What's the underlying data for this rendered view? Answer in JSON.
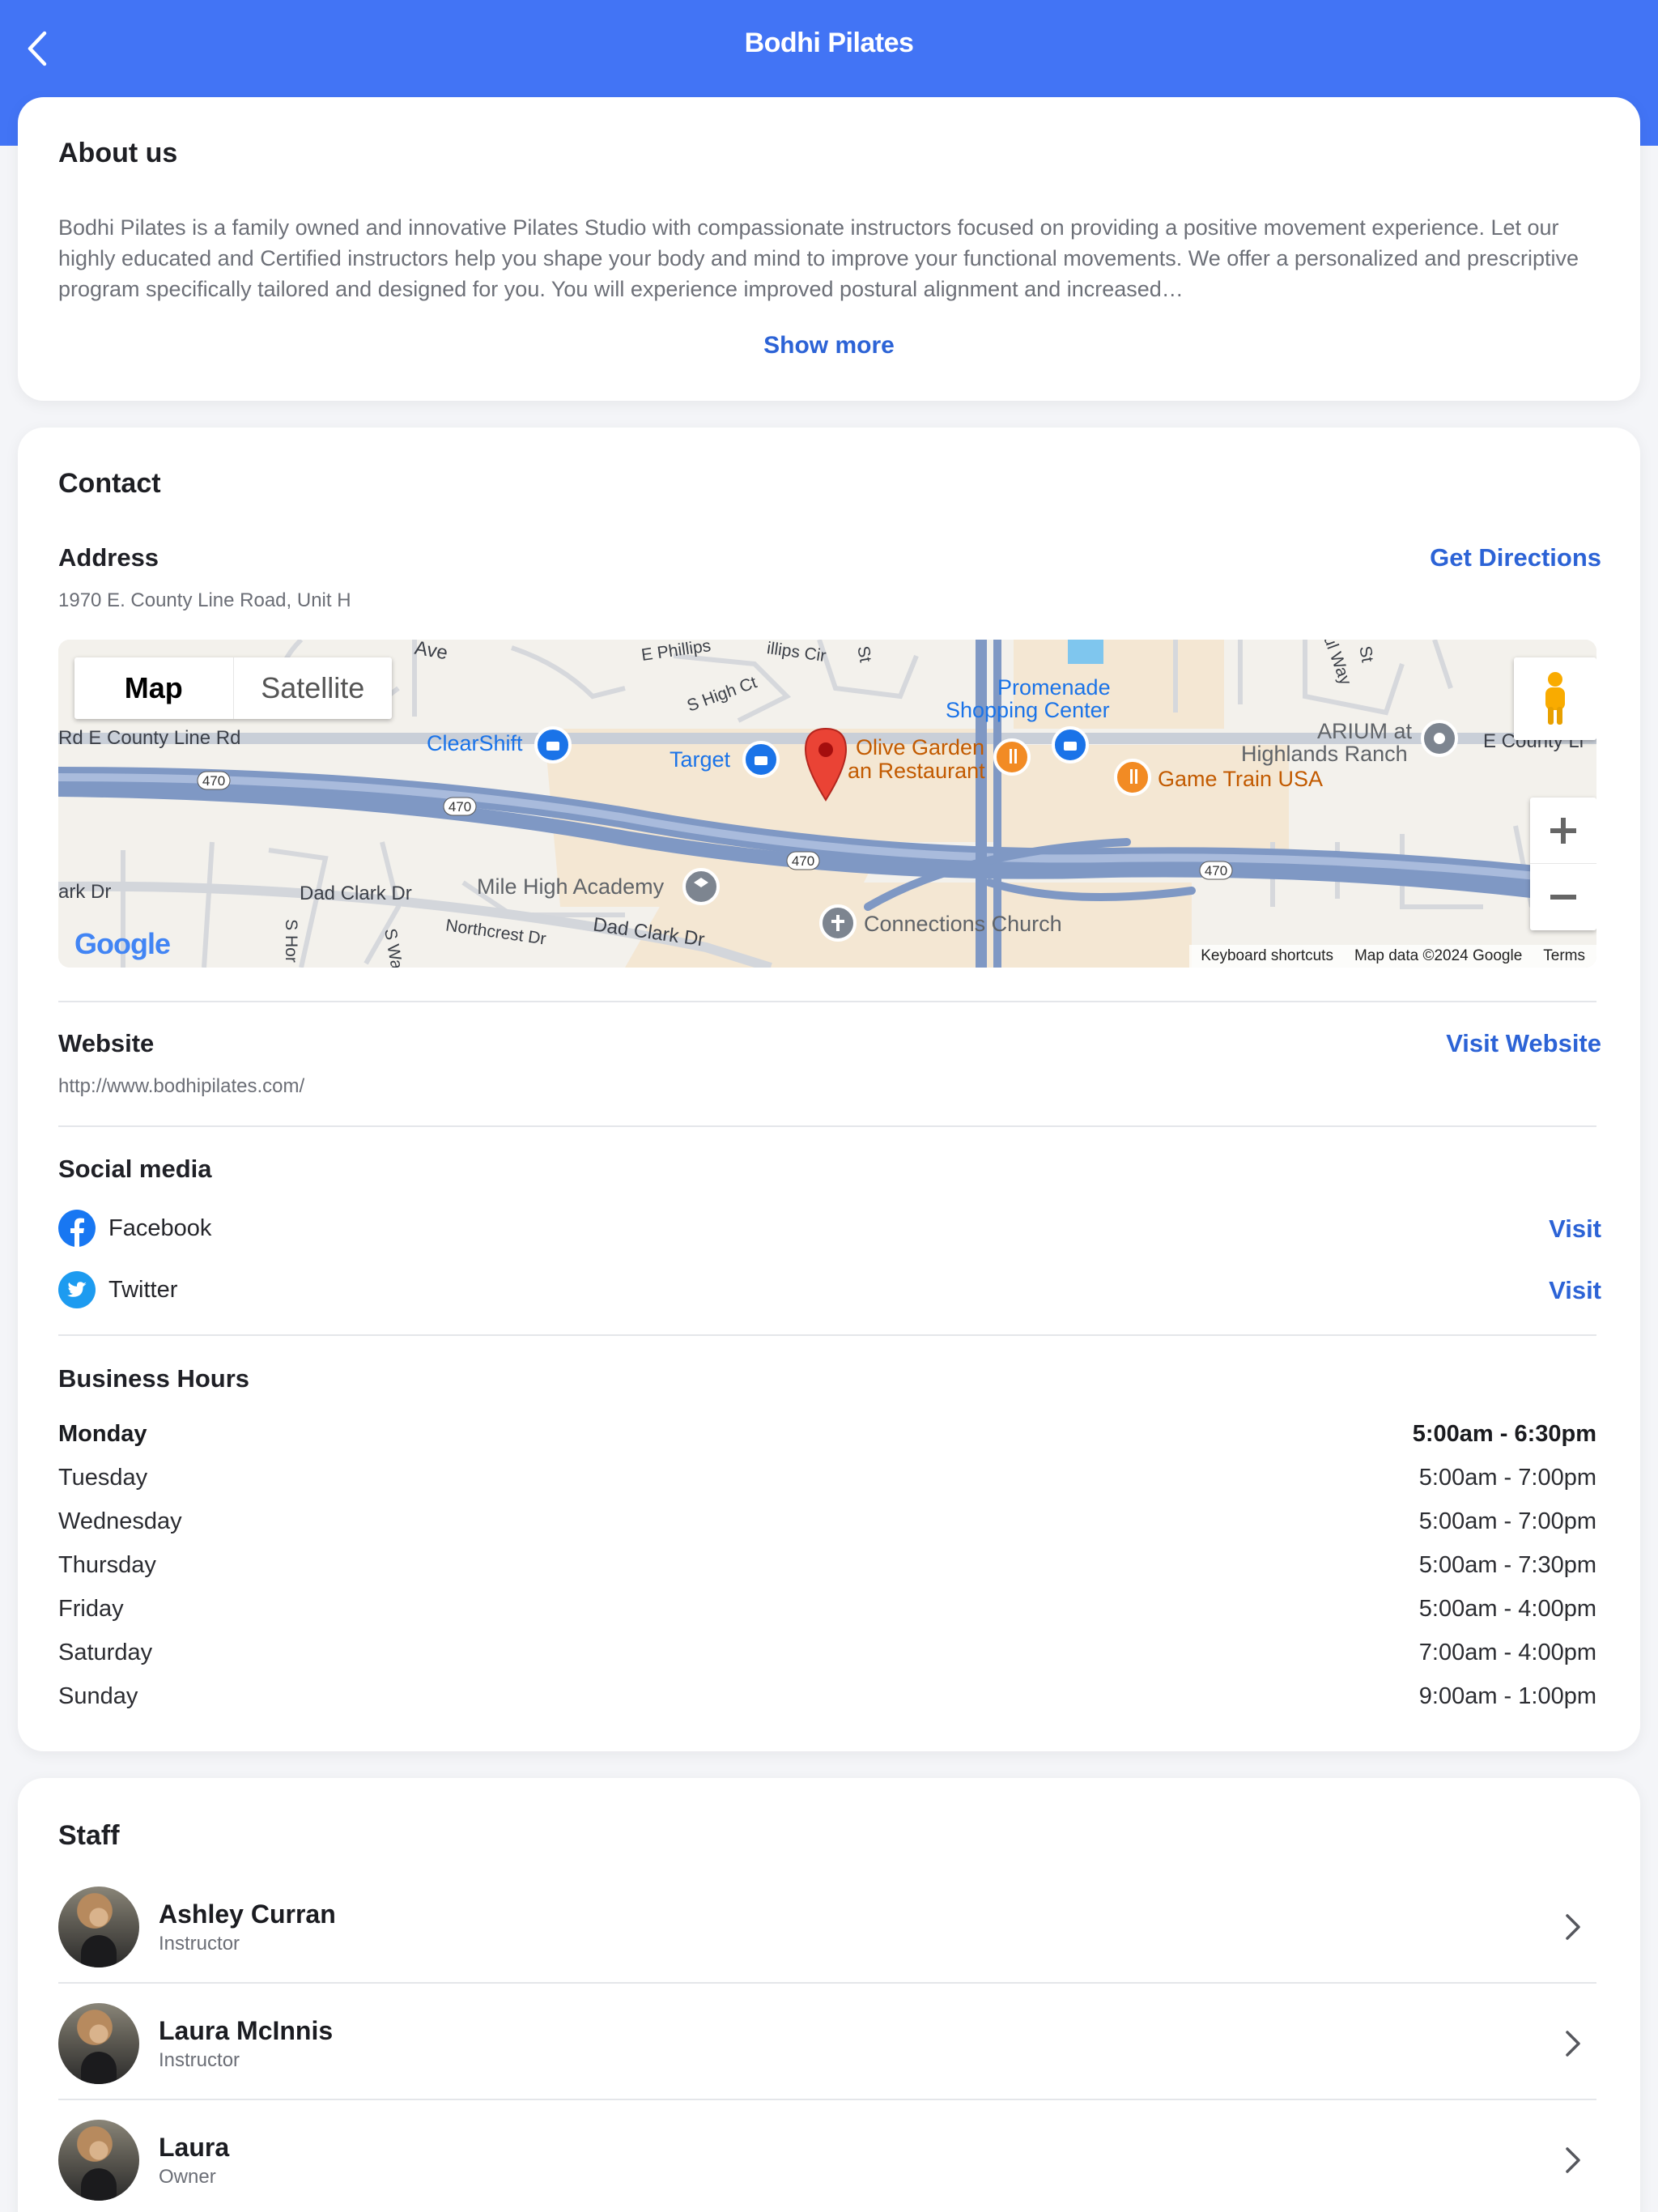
{
  "header": {
    "title": "Bodhi Pilates",
    "back_icon": "chevron-left-icon",
    "background": "#4274f5"
  },
  "about": {
    "title": "About us",
    "text": "Bodhi Pilates is a family owned and innovative Pilates Studio with compassionate instructors focused on providing a positive movement experience.  Let our highly educated and Certified instructors help you shape your body and mind to improve your functional movements.  We offer a personalized and prescriptive program specifically tailored and designed for you.  You will experience improved postural alignment and increased…",
    "show_more": "Show more"
  },
  "contact": {
    "title": "Contact",
    "address_label": "Address",
    "address_value": "1970 E. County Line Road, Unit H",
    "directions_link": "Get Directions",
    "map": {
      "toggle_map": "Map",
      "toggle_satellite": "Satellite",
      "logo": "Google",
      "footer": {
        "shortcuts": "Keyboard shortcuts",
        "data": "Map data ©2024 Google",
        "terms": "Terms"
      },
      "labels": {
        "county_line_rd": "Rd  E County Line Rd",
        "e_county_li": "E County Li",
        "clearshift": "ClearShift",
        "target": "Target",
        "olive_garden": "Olive Garden",
        "an_restaurant": "an Restaurant",
        "promenade_1": "Promenade",
        "promenade_2": "Shopping Center",
        "arium_1": "ARIUM at",
        "arium_2": "Highlands Ranch",
        "game_train": "Game Train USA",
        "mile_high": "Mile High Academy",
        "connections": "Connections Church",
        "dad_clark_1": "Dad Clark Dr",
        "dad_clark_2": "Dad Clark Dr",
        "northcrest": "Northcrest Dr",
        "ark_dr": "ark Dr",
        "e_phillips": "E Phillips",
        "phillips_cir": "illips Cir",
        "s_high_ct": "S High Ct",
        "ave": "Ave",
        "hwy_470": "470",
        "s_hor": "S Hor",
        "s_wa": "S Wa",
        "aul_way": "aul Way",
        "st_1": "St",
        "st_2": "St"
      }
    },
    "website_label": "Website",
    "website_value": "http://www.bodhipilates.com/",
    "website_link": "Visit Website",
    "social_label": "Social media",
    "social": [
      {
        "name": "Facebook",
        "icon": "facebook-icon",
        "link": "Visit",
        "color": "#1877f2"
      },
      {
        "name": "Twitter",
        "icon": "twitter-icon",
        "link": "Visit",
        "color": "#1d9bf0"
      }
    ],
    "hours_label": "Business Hours",
    "hours": [
      {
        "day": "Monday",
        "time": "5:00am - 6:30pm",
        "today": true
      },
      {
        "day": "Tuesday",
        "time": "5:00am - 7:00pm"
      },
      {
        "day": "Wednesday",
        "time": "5:00am - 7:00pm"
      },
      {
        "day": "Thursday",
        "time": "5:00am - 7:30pm"
      },
      {
        "day": "Friday",
        "time": "5:00am - 4:00pm"
      },
      {
        "day": "Saturday",
        "time": "7:00am - 4:00pm"
      },
      {
        "day": "Sunday",
        "time": "9:00am - 1:00pm"
      }
    ]
  },
  "staff": {
    "title": "Staff",
    "members": [
      {
        "name": "Ashley Curran",
        "role": "Instructor"
      },
      {
        "name": "Laura McInnis",
        "role": "Instructor"
      },
      {
        "name": "Laura",
        "role": "Owner"
      }
    ]
  }
}
